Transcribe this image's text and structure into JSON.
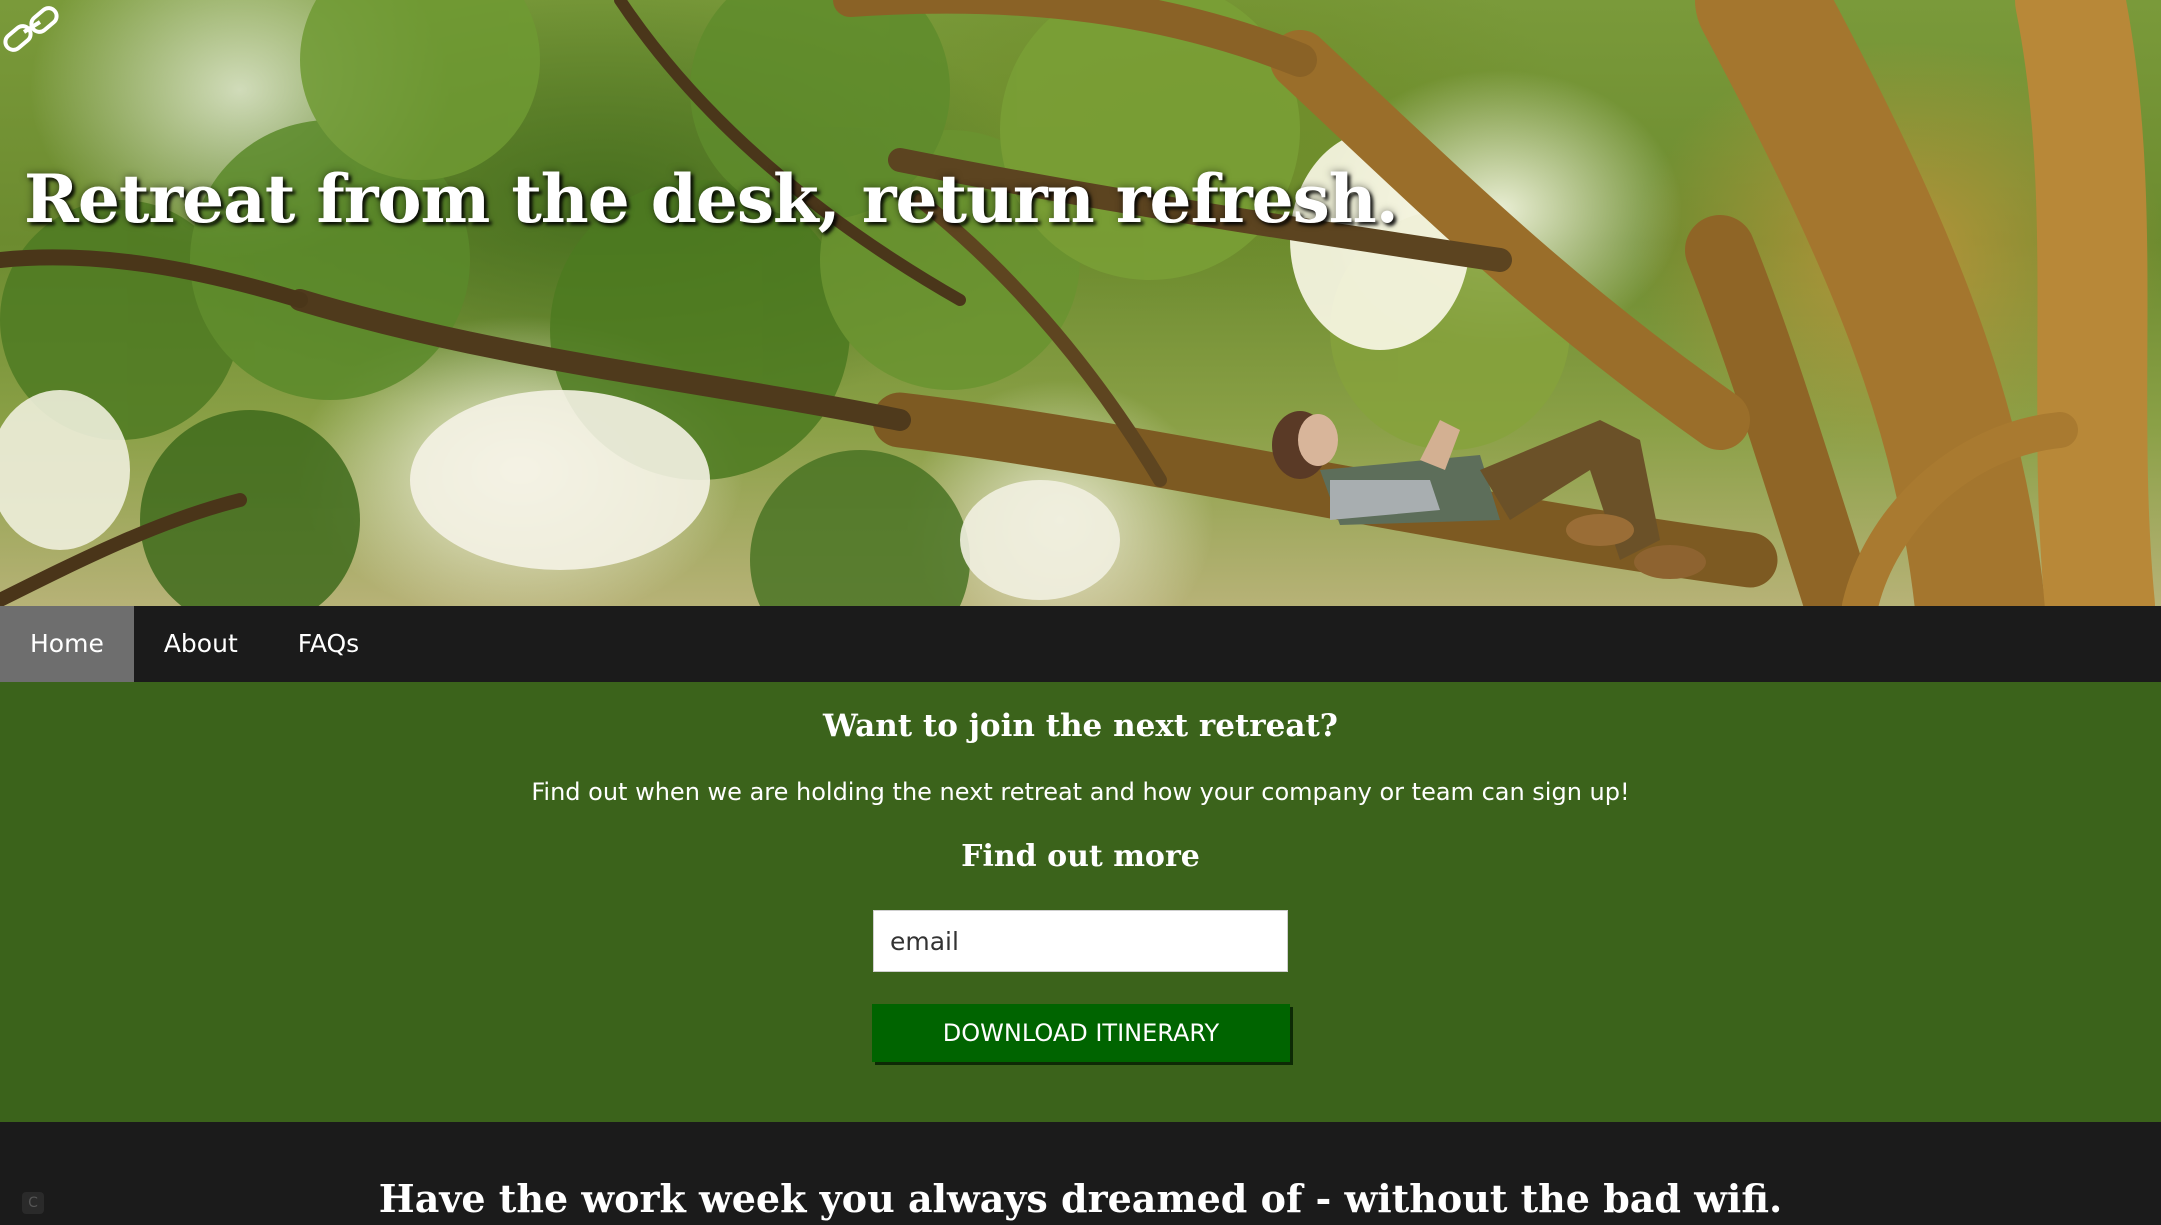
{
  "hero": {
    "title": "Retreat from the desk, return refresh.",
    "logo_icon": "chain-link-icon"
  },
  "nav": {
    "items": [
      {
        "label": "Home",
        "active": true
      },
      {
        "label": "About",
        "active": false
      },
      {
        "label": "FAQs",
        "active": false
      }
    ]
  },
  "signup": {
    "heading": "Want to join the next retreat?",
    "text": "Find out when we are holding the next retreat and how your company or team can sign up!",
    "subheading": "Find out more",
    "email_placeholder": "email",
    "button_label": "DOWNLOAD ITINERARY"
  },
  "footer": {
    "heading": "Have the work week you always dreamed of - without the bad wifi.",
    "corner_badge": "C"
  },
  "colors": {
    "nav_bg": "#1b1b1b",
    "nav_active_bg": "#6e6e6e",
    "signup_bg": "#3b631b",
    "button_bg": "#006400"
  }
}
